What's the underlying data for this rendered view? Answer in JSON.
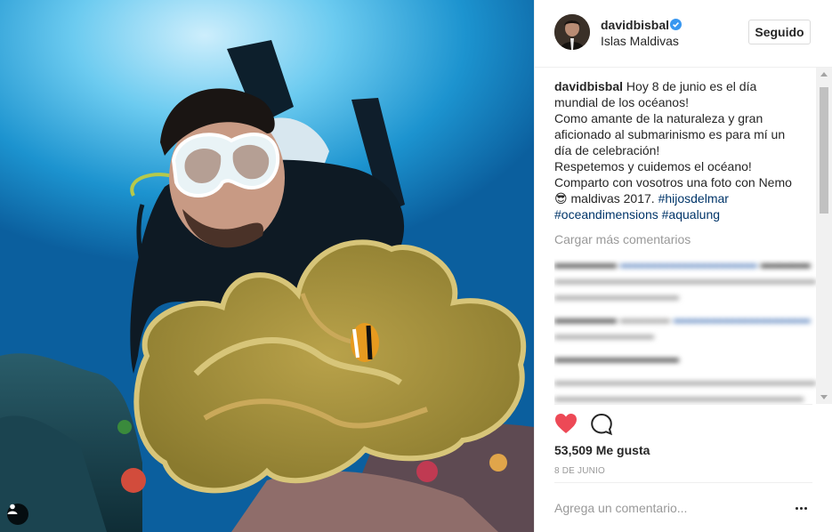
{
  "post": {
    "username": "davidbisbal",
    "location": "Islas Maldivas",
    "follow_label": "Seguido",
    "caption_user": "davidbisbal",
    "caption_lines": [
      "Hoy 8 de junio es el día",
      "mundial de los océanos!",
      "Como amante de la naturaleza y gran",
      "aficionado al submarinismo es para mí un",
      "día de celebración!",
      "Respetemos y cuidemos el océano!",
      "Comparto con vosotros una foto con Nemo"
    ],
    "caption_tail": "maldivas 2017.",
    "hashtags": [
      "#hijosdelmar",
      "#oceandimensions",
      "#aqualung"
    ],
    "emoji": "😎",
    "load_more": "Cargar más comentarios",
    "likes": "53,509 Me gusta",
    "date": "8 de junio",
    "comment_placeholder": "Agrega un comentario..."
  },
  "icons": {
    "verified": "verified-badge-icon",
    "like": "heart-icon",
    "comment": "speech-bubble-icon",
    "more": "more-options-icon",
    "tag": "user-tag-icon"
  },
  "colors": {
    "heart": "#ed4956",
    "verified": "#3897f0",
    "hashtag": "#003569"
  }
}
